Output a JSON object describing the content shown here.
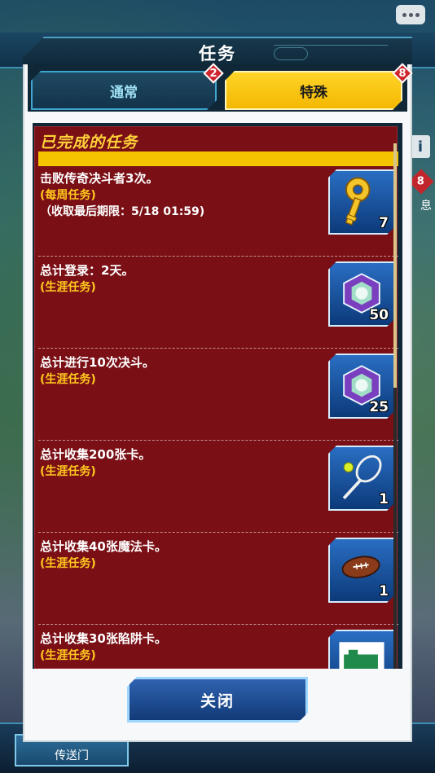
{
  "modal": {
    "title": "任务",
    "tabs": [
      {
        "label": "通常",
        "badge": "2",
        "active": false
      },
      {
        "label": "特殊",
        "badge": "8",
        "active": true
      }
    ],
    "section_title": "已完成的任务",
    "missions": [
      {
        "title": "击败传奇决斗者3次。",
        "category": "(每周任务)",
        "deadline": "（收取最后期限：5/18 01:59)",
        "reward_icon": "gold-key-icon",
        "reward_count": "7"
      },
      {
        "title": "总计登录：2天。",
        "category": "(生涯任务)",
        "deadline": "",
        "reward_icon": "gem-icon",
        "reward_count": "50"
      },
      {
        "title": "总计进行10次决斗。",
        "category": "(生涯任务)",
        "deadline": "",
        "reward_icon": "gem-icon",
        "reward_count": "25"
      },
      {
        "title": "总计收集200张卡。",
        "category": "(生涯任务)",
        "deadline": "",
        "reward_icon": "tennis-racket-icon",
        "reward_count": "1"
      },
      {
        "title": "总计收集40张魔法卡。",
        "category": "(生涯任务)",
        "deadline": "",
        "reward_icon": "football-icon",
        "reward_count": "1"
      },
      {
        "title": "总计收集30张陷阱卡。",
        "category": "(生涯任务)",
        "deadline": "",
        "reward_icon": "card-art-icon",
        "reward_count": ""
      }
    ],
    "close_label": "关闭"
  },
  "background": {
    "side_badge": "8",
    "side_text": "息",
    "portal_label": "传送门"
  },
  "colors": {
    "accent_yellow": "#f5c400",
    "list_red": "#7a1016",
    "category_yellow": "#ffc81e",
    "badge_red": "#d0262e"
  }
}
